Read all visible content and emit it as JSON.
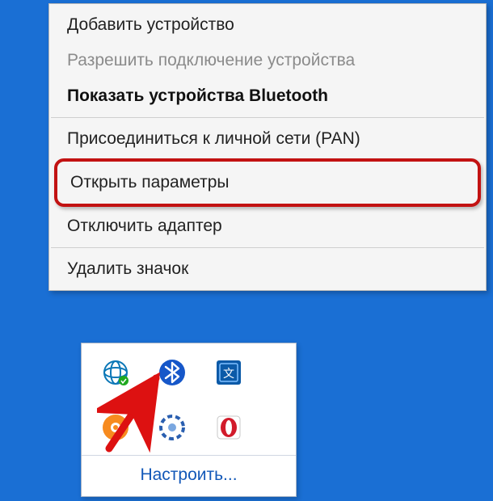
{
  "menu": {
    "add_device": "Добавить устройство",
    "allow_connection": "Разрешить подключение устройства",
    "show_bt_devices": "Показать устройства Bluetooth",
    "join_pan": "Присоединиться к личной сети (PAN)",
    "open_settings": "Открыть параметры",
    "disable_adapter": "Отключить адаптер",
    "remove_icon": "Удалить значок"
  },
  "tray": {
    "customize": "Настроить..."
  },
  "icons": {
    "orb": "globe-icon",
    "bluetooth": "bluetooth-icon",
    "lang": "input-method-icon",
    "avast": "antivirus-icon",
    "spinner": "loading-icon",
    "opera": "opera-icon"
  }
}
